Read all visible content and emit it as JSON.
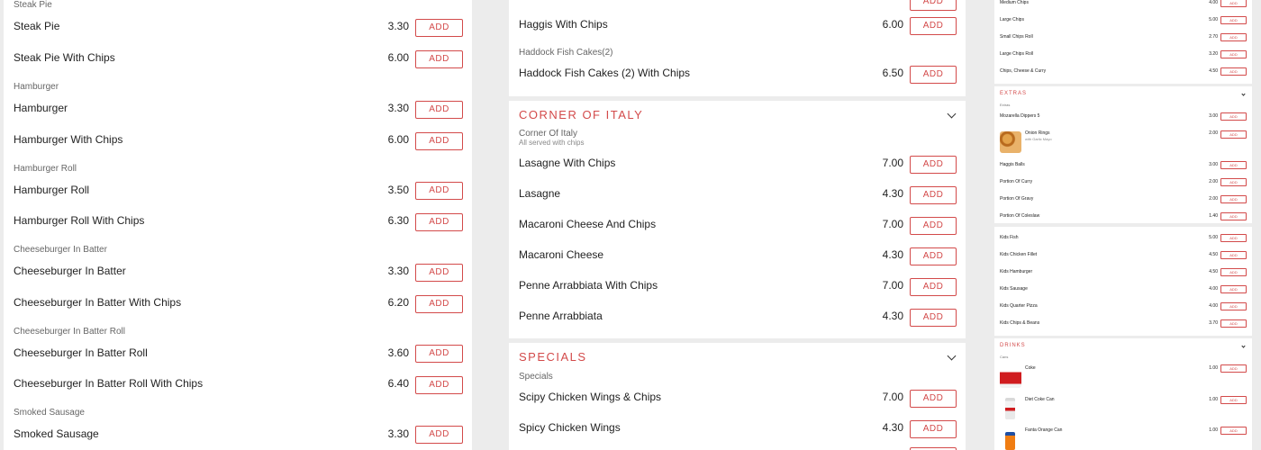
{
  "buttons": {
    "add_label": "ADD"
  },
  "left_column": {
    "groups": [
      {
        "category": "Steak Pie",
        "items": [
          {
            "name": "Steak Pie",
            "price": "3.30"
          },
          {
            "name": "Steak Pie With Chips",
            "price": "6.00"
          }
        ]
      },
      {
        "category": "Hamburger",
        "items": [
          {
            "name": "Hamburger",
            "price": "3.30"
          },
          {
            "name": "Hamburger With Chips",
            "price": "6.00"
          }
        ]
      },
      {
        "category": "Hamburger Roll",
        "items": [
          {
            "name": "Hamburger Roll",
            "price": "3.50"
          },
          {
            "name": "Hamburger Roll With Chips",
            "price": "6.30"
          }
        ]
      },
      {
        "category": "Cheeseburger In Batter",
        "items": [
          {
            "name": "Cheeseburger In Batter",
            "price": "3.30"
          },
          {
            "name": "Cheeseburger In Batter With Chips",
            "price": "6.20"
          }
        ]
      },
      {
        "category": "Cheeseburger In Batter Roll",
        "items": [
          {
            "name": "Cheeseburger In Batter Roll",
            "price": "3.60"
          },
          {
            "name": "Cheeseburger In Batter Roll With Chips",
            "price": "6.40"
          }
        ]
      },
      {
        "category": "Smoked Sausage",
        "items": [
          {
            "name": "Smoked Sausage",
            "price": "3.30"
          }
        ]
      }
    ]
  },
  "middle_column": {
    "top_items": [
      {
        "name": "Haggis With Chips",
        "price": "6.00"
      }
    ],
    "haddock": {
      "category": "Haddock Fish Cakes(2)",
      "items": [
        {
          "name": "Haddock Fish Cakes (2) With Chips",
          "price": "6.50"
        }
      ]
    },
    "italy": {
      "title": "CORNER OF ITALY",
      "category": "Corner Of Italy",
      "subtitle": "All served with chips",
      "items": [
        {
          "name": "Lasagne With Chips",
          "price": "7.00"
        },
        {
          "name": "Lasagne",
          "price": "4.30"
        },
        {
          "name": "Macaroni Cheese And Chips",
          "price": "7.00"
        },
        {
          "name": "Macaroni Cheese",
          "price": "4.30"
        },
        {
          "name": "Penne Arrabbiata With Chips",
          "price": "7.00"
        },
        {
          "name": "Penne Arrabbiata",
          "price": "4.30"
        }
      ]
    },
    "specials": {
      "title": "SPECIALS",
      "category": "Specials",
      "items": [
        {
          "name": "Scipy Chicken Wings & Chips",
          "price": "7.00"
        },
        {
          "name": "Spicy Chicken Wings",
          "price": "4.30"
        }
      ]
    }
  },
  "right_column": {
    "chips_items": [
      {
        "name": "Medium Chips",
        "price": "4.00"
      },
      {
        "name": "Large Chips",
        "price": "5.00"
      },
      {
        "name": "Small Chips Roll",
        "price": "2.70"
      },
      {
        "name": "Large Chips Roll",
        "price": "3.20"
      },
      {
        "name": "Chips, Cheese & Curry",
        "price": "4.50"
      }
    ],
    "extras": {
      "title": "EXTRAS",
      "category": "Extras",
      "items": [
        {
          "name": "Mozarella Dippers 5",
          "price": "3.00"
        },
        {
          "name": "Onion Rings",
          "desc": "with Garlic Mayo",
          "price": "2.00"
        },
        {
          "name": "Haggis Balls",
          "price": "3.00"
        },
        {
          "name": "Portion Of Curry",
          "price": "2.00"
        },
        {
          "name": "Portion Of Gravy",
          "price": "2.00"
        },
        {
          "name": "Portion Of Coleslaw",
          "price": "1.40"
        }
      ]
    },
    "kids_items": [
      {
        "name": "Kids Fish",
        "price": "5.00"
      },
      {
        "name": "Kids Chicken Fillet",
        "price": "4.50"
      },
      {
        "name": "Kids Hamburger",
        "price": "4.50"
      },
      {
        "name": "Kids Sausage",
        "price": "4.00"
      },
      {
        "name": "Kids Quarter Pizza",
        "price": "4.00"
      },
      {
        "name": "Kids Chips & Beans",
        "price": "3.70"
      }
    ],
    "drinks": {
      "title": "DRINKS",
      "category": "Cans",
      "items": [
        {
          "name": "Coke",
          "price": "1.00"
        },
        {
          "name": "Diet Coke Can",
          "price": "1.00"
        },
        {
          "name": "Fanta Orange Can",
          "price": "1.00"
        }
      ]
    }
  },
  "colors": {
    "accent": "#d34a4a",
    "background": "#ececec",
    "card": "#ffffff"
  }
}
